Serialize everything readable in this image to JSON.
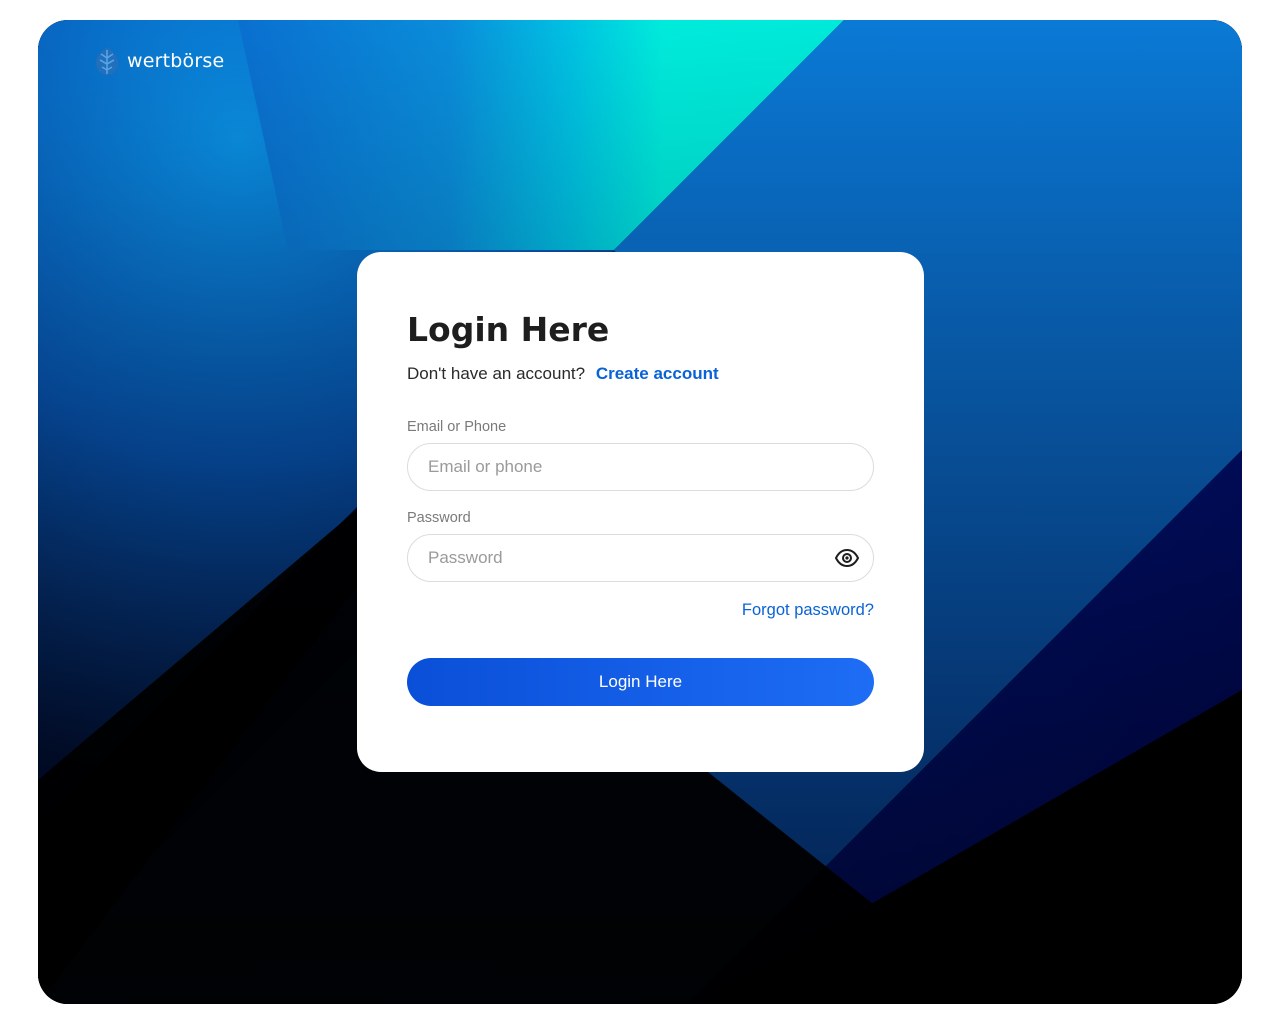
{
  "brand": {
    "name": "wertbörse",
    "logo_icon": "leaf-logo-icon"
  },
  "login": {
    "title": "Login Here",
    "no_account_text": "Don't have an account?",
    "create_account_label": "Create account",
    "email_label": "Email or Phone",
    "email_placeholder": "Email or phone",
    "email_value": "",
    "password_label": "Password",
    "password_placeholder": "Password",
    "password_value": "",
    "password_toggle_icon": "eye-icon",
    "forgot_label": "Forgot password?",
    "submit_label": "Login Here"
  },
  "colors": {
    "accent": "#0a63d6",
    "button_start": "#0a4fd8",
    "button_end": "#1e6df5",
    "background_cyan": "#00f0e0",
    "background_blue": "#0a7ad6",
    "background_navy": "#000a6b",
    "background_black": "#000000"
  }
}
